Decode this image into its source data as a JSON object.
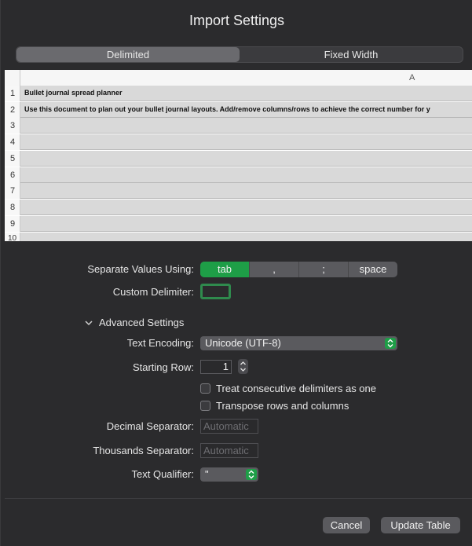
{
  "dialog": {
    "title": "Import Settings"
  },
  "mode_tabs": [
    {
      "label": "Delimited",
      "selected": true
    },
    {
      "label": "Fixed Width",
      "selected": false
    }
  ],
  "preview": {
    "column_header": "A",
    "rows": [
      {
        "num": "1",
        "text": "Bullet journal spread planner"
      },
      {
        "num": "2",
        "text": "Use this document to plan out your bullet journal layouts. Add/remove columns/rows to achieve the correct number for y"
      },
      {
        "num": "3",
        "text": ""
      },
      {
        "num": "4",
        "text": ""
      },
      {
        "num": "5",
        "text": ""
      },
      {
        "num": "6",
        "text": ""
      },
      {
        "num": "7",
        "text": ""
      },
      {
        "num": "8",
        "text": ""
      },
      {
        "num": "9",
        "text": ""
      },
      {
        "num": "10",
        "text": ""
      }
    ]
  },
  "settings": {
    "separate_label": "Separate Values Using:",
    "delimiters": [
      {
        "label": "tab",
        "active": true
      },
      {
        "label": ",",
        "active": false
      },
      {
        "label": ";",
        "active": false
      },
      {
        "label": "space",
        "active": false
      }
    ],
    "custom_delimiter_label": "Custom Delimiter:",
    "custom_delimiter_value": "",
    "advanced_label": "Advanced Settings",
    "text_encoding_label": "Text Encoding:",
    "text_encoding_value": "Unicode (UTF-8)",
    "starting_row_label": "Starting Row:",
    "starting_row_value": "1",
    "consecutive_label": "Treat consecutive delimiters as one",
    "transpose_label": "Transpose rows and columns",
    "decimal_label": "Decimal Separator:",
    "decimal_placeholder": "Automatic",
    "thousands_label": "Thousands Separator:",
    "thousands_placeholder": "Automatic",
    "qualifier_label": "Text Qualifier:",
    "qualifier_value": "\""
  },
  "buttons": {
    "cancel": "Cancel",
    "update": "Update Table"
  },
  "colors": {
    "accent": "#1e9e47",
    "background": "#2b2b2d"
  }
}
